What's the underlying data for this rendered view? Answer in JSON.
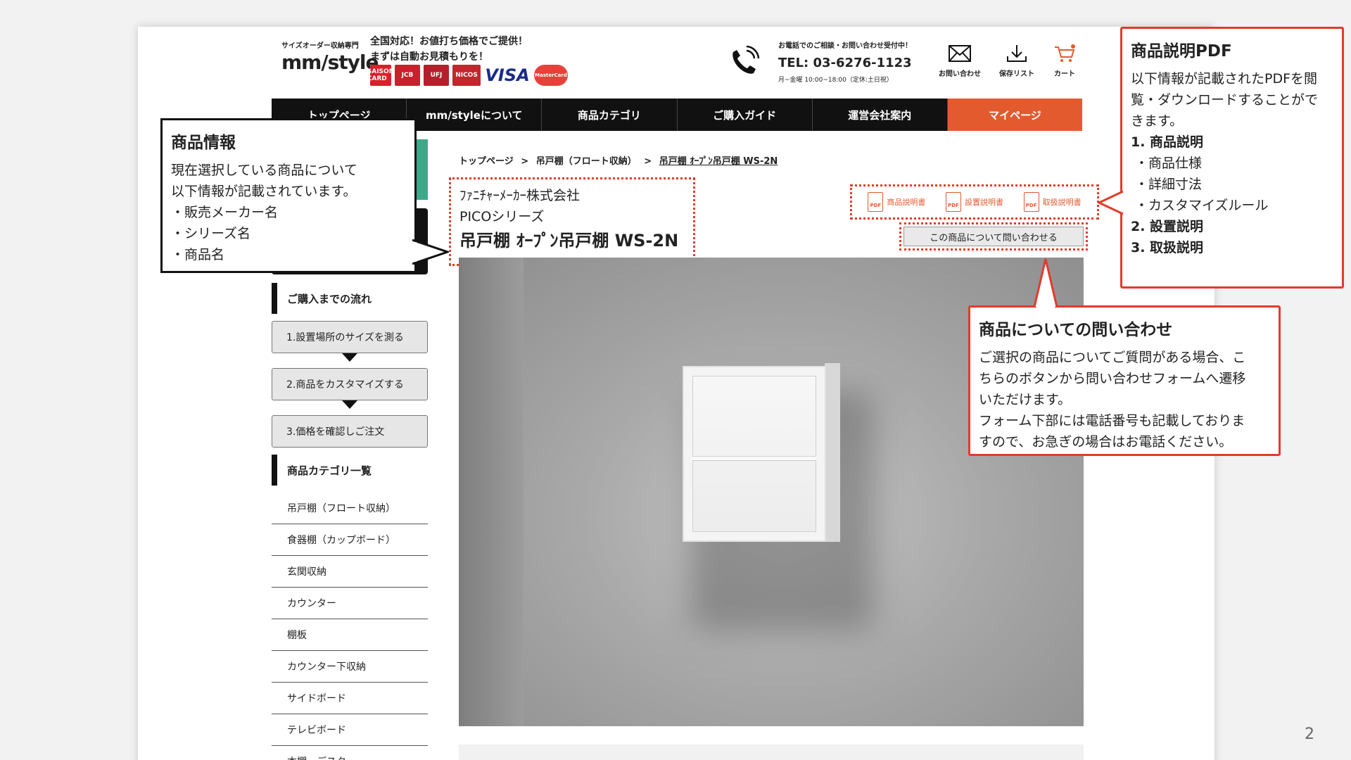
{
  "header": {
    "logo_sub": "サイズオーダー収納専門",
    "logo_main": "mm/style",
    "tagline_1": "全国対応！お値打ち価格でご提供！",
    "tagline_2": "まずは自動お見積もりを！",
    "cards": [
      "SAISON CARD",
      "JCB",
      "UFJ",
      "NICOS",
      "VISA",
      "MasterCard"
    ],
    "phone_note": "お電話でのご相談・お問い合わせ受付中！",
    "phone_tel": "TEL: 03-6276-1123",
    "phone_hours": "月~金曜 10:00~18:00（定休:土日祝）",
    "icons": {
      "contact": "お問い合わせ",
      "saved": "保存リスト",
      "cart": "カート"
    }
  },
  "nav": [
    "トップページ",
    "mm/styleについて",
    "商品カテゴリ",
    "ご購入ガイド",
    "運営会社案内",
    "マイページ"
  ],
  "sidebar": {
    "flow_heading": "ご購入までの流れ",
    "flow_steps": [
      "1.設置場所のサイズを測る",
      "2.商品をカスタマイズする",
      "3.価格を確認しご注文"
    ],
    "category_heading": "商品カテゴリ一覧",
    "categories": [
      "吊戸棚（フロート収納）",
      "食器棚（カップボード）",
      "玄関収納",
      "カウンター",
      "棚板",
      "カウンター下収納",
      "サイドボード",
      "テレビボード",
      "本棚・デスク"
    ]
  },
  "main": {
    "breadcrumb": [
      "トップページ",
      ">",
      "吊戸棚（フロート収納）",
      ">",
      "吊戸棚 ｵｰﾌﾟﾝ吊戸棚 WS-2N"
    ],
    "maker": "ﾌｧﾆﾁｬｰﾒｰｶｰ株式会社",
    "series": "PICOシリーズ",
    "product_name": "吊戸棚 ｵｰﾌﾟﾝ吊戸棚 WS-2N",
    "pdf_buttons": [
      "商品説明書",
      "設置説明書",
      "取扱説明書"
    ],
    "pdf_icon_text": "PDF",
    "inquiry_button": "この商品について問い合わせる"
  },
  "callouts": {
    "product_info": {
      "title": "商品情報",
      "lines": [
        "現在選択している商品について",
        "以下情報が記載されています。",
        "・販売メーカー名",
        "・シリーズ名",
        "・商品名"
      ]
    },
    "pdf": {
      "title": "商品説明PDF",
      "lines": [
        "以下情報が記載されたPDFを閲",
        "覧・ダウンロードすることがで",
        "きます。"
      ],
      "items": [
        "1. 商品説明",
        "・商品仕様",
        "・詳細寸法",
        "・カスタマイズルール",
        "2. 設置説明",
        "3. 取扱説明"
      ]
    },
    "inquiry": {
      "title": "商品についての問い合わせ",
      "lines": [
        "ご選択の商品についてご質問がある場合、こ",
        "ちらのボタンから問い合わせフォームへ遷移",
        "いただけます。",
        "フォーム下部には電話番号も記載しておりま",
        "すので、お急ぎの場合はお電話ください。"
      ]
    }
  },
  "page_number": "2",
  "colors": {
    "accent": "#e35a2f",
    "callout_red": "#e33b2a",
    "nav_bg": "#111111",
    "green": "#3ea988"
  }
}
